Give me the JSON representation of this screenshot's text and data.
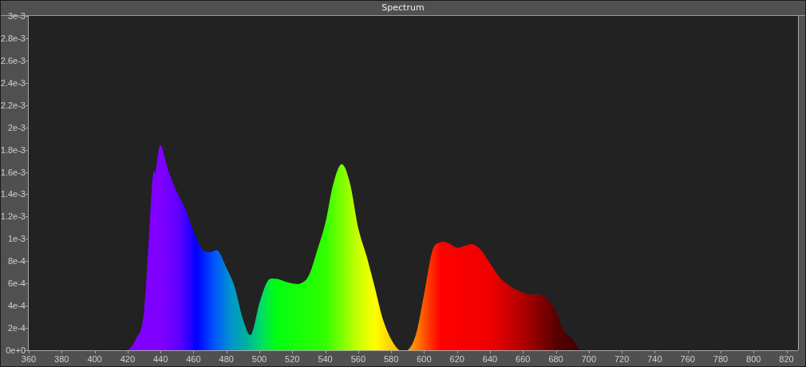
{
  "window": {
    "title": "Spectrum"
  },
  "chart": {
    "chart_data": {
      "type": "area",
      "xlim": [
        360,
        827
      ],
      "ylim": [
        0,
        0.003
      ],
      "xticks": [
        360,
        380,
        400,
        420,
        440,
        460,
        480,
        500,
        520,
        540,
        560,
        580,
        600,
        620,
        640,
        660,
        680,
        700,
        720,
        740,
        760,
        780,
        800,
        820
      ],
      "yticks": [
        {
          "value": 0,
          "label": "0e+0"
        },
        {
          "value": 0.0002,
          "label": "2e-4"
        },
        {
          "value": 0.0004,
          "label": "4e-4"
        },
        {
          "value": 0.0006,
          "label": "6e-4"
        },
        {
          "value": 0.0008,
          "label": "8e-4"
        },
        {
          "value": 0.001,
          "label": "1e-3"
        },
        {
          "value": 0.0012,
          "label": "1.2e-3"
        },
        {
          "value": 0.0014,
          "label": "1.4e-3"
        },
        {
          "value": 0.0016,
          "label": "1.6e-3"
        },
        {
          "value": 0.0018,
          "label": "1.8e-3"
        },
        {
          "value": 0.002,
          "label": "2e-3"
        },
        {
          "value": 0.0022,
          "label": "2.2e-3"
        },
        {
          "value": 0.0024,
          "label": "2.4e-3"
        },
        {
          "value": 0.0026,
          "label": "2.6e-3"
        },
        {
          "value": 0.0028,
          "label": "2.8e-3"
        },
        {
          "value": 0.003,
          "label": "3e-3"
        }
      ],
      "x": [
        415,
        420,
        425,
        430,
        435,
        437,
        440,
        445,
        450,
        455,
        460,
        465,
        470,
        475,
        480,
        485,
        490,
        495,
        500,
        505,
        510,
        515,
        520,
        525,
        530,
        535,
        540,
        545,
        550,
        555,
        560,
        565,
        570,
        575,
        580,
        585,
        590,
        595,
        600,
        605,
        610,
        615,
        620,
        625,
        630,
        635,
        640,
        645,
        650,
        655,
        660,
        665,
        670,
        675,
        680,
        685,
        690,
        695,
        700,
        705,
        710
      ],
      "series": [
        {
          "values": [
            0,
            0,
            0.0001,
            0.00035,
            0.0015,
            0.0016,
            0.00184,
            0.0016,
            0.00142,
            0.00127,
            0.00107,
            0.00091,
            0.00088,
            0.00089,
            0.00074,
            0.00057,
            0.00028,
            0.00014,
            0.00042,
            0.00062,
            0.00064,
            0.00062,
            0.0006,
            0.0006,
            0.00067,
            0.00089,
            0.00114,
            0.0015,
            0.00167,
            0.0015,
            0.0011,
            0.00085,
            0.00057,
            0.00028,
            0.0001,
            0,
            0,
            0.00014,
            0.0005,
            0.00089,
            0.00097,
            0.00096,
            0.00092,
            0.00094,
            0.00095,
            0.00089,
            0.00078,
            0.00067,
            0.0006,
            0.00055,
            0.00052,
            0.0005,
            0.0005,
            0.00046,
            0.00035,
            0.00017,
            0.0001,
            0,
            0,
            0,
            0
          ]
        }
      ]
    }
  }
}
